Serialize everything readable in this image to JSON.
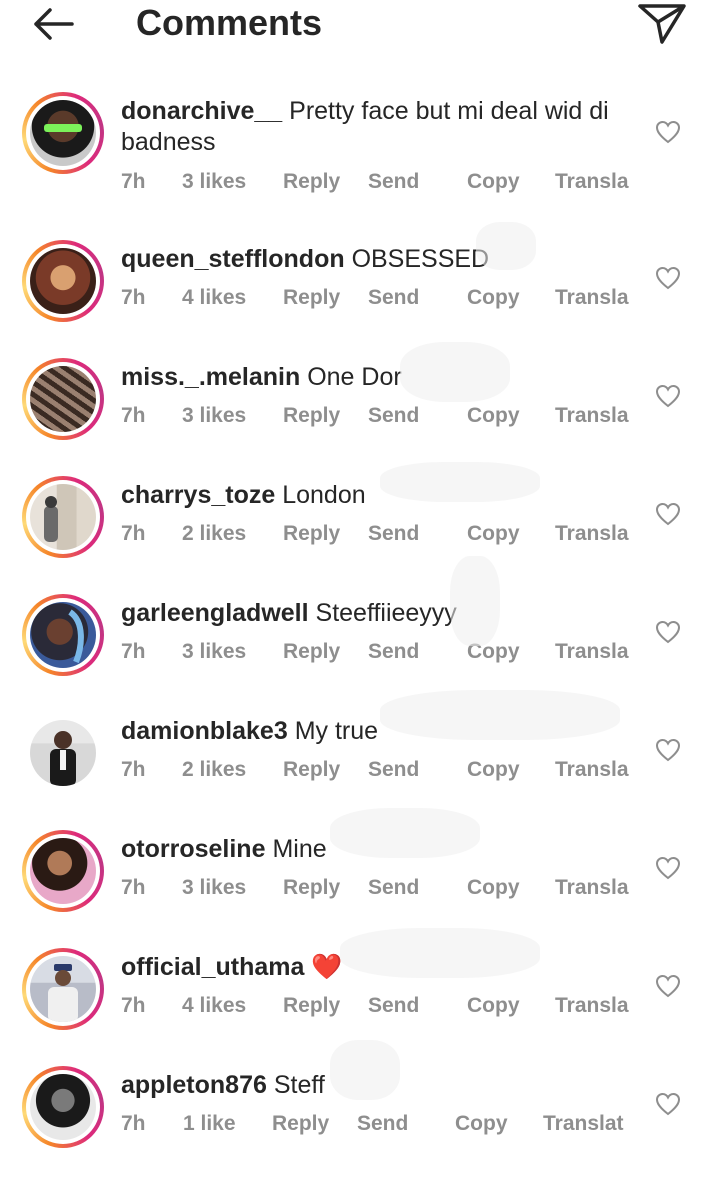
{
  "header": {
    "title": "Comments"
  },
  "comments": [
    {
      "username": "donarchive__",
      "text": "Pretty face but mi deal wid di badness",
      "time": "7h",
      "likes": "3 likes",
      "reply": "Reply",
      "send": "Send",
      "copy": "Copy",
      "translate": "Transla"
    },
    {
      "username": "queen_stefflondon",
      "text": "OBSESSED",
      "time": "7h",
      "likes": "4 likes",
      "reply": "Reply",
      "send": "Send",
      "copy": "Copy",
      "translate": "Transla"
    },
    {
      "username": "miss._.melanin",
      "text": "One Dor",
      "time": "7h",
      "likes": "3 likes",
      "reply": "Reply",
      "send": "Send",
      "copy": "Copy",
      "translate": "Transla"
    },
    {
      "username": "charrys_toze",
      "text": "London",
      "time": "7h",
      "likes": "2 likes",
      "reply": "Reply",
      "send": "Send",
      "copy": "Copy",
      "translate": "Transla"
    },
    {
      "username": "garleengladwell",
      "text": "Steeffiieeyyy",
      "time": "7h",
      "likes": "3 likes",
      "reply": "Reply",
      "send": "Send",
      "copy": "Copy",
      "translate": "Transla"
    },
    {
      "username": "damionblake3",
      "text": "My true",
      "time": "7h",
      "likes": "2 likes",
      "reply": "Reply",
      "send": "Send",
      "copy": "Copy",
      "translate": "Transla"
    },
    {
      "username": "otorroseline",
      "text": "Mine",
      "time": "7h",
      "likes": "3 likes",
      "reply": "Reply",
      "send": "Send",
      "copy": "Copy",
      "translate": "Transla"
    },
    {
      "username": "official_uthama",
      "text": "❤️",
      "time": "7h",
      "likes": "4 likes",
      "reply": "Reply",
      "send": "Send",
      "copy": "Copy",
      "translate": "Transla"
    },
    {
      "username": "appleton876",
      "text": "Steff",
      "time": "7h",
      "likes": "1 like",
      "reply": "Reply",
      "send": "Send",
      "copy": "Copy",
      "translate": "Translat"
    }
  ],
  "icons": {
    "back": "back-arrow-icon",
    "direct": "paper-plane-icon",
    "like": "heart-outline-icon"
  },
  "colors": {
    "text": "#262626",
    "meta": "#8e8e8e",
    "story_ring_start": "#f58529",
    "story_ring_end": "#dd2a7b"
  }
}
